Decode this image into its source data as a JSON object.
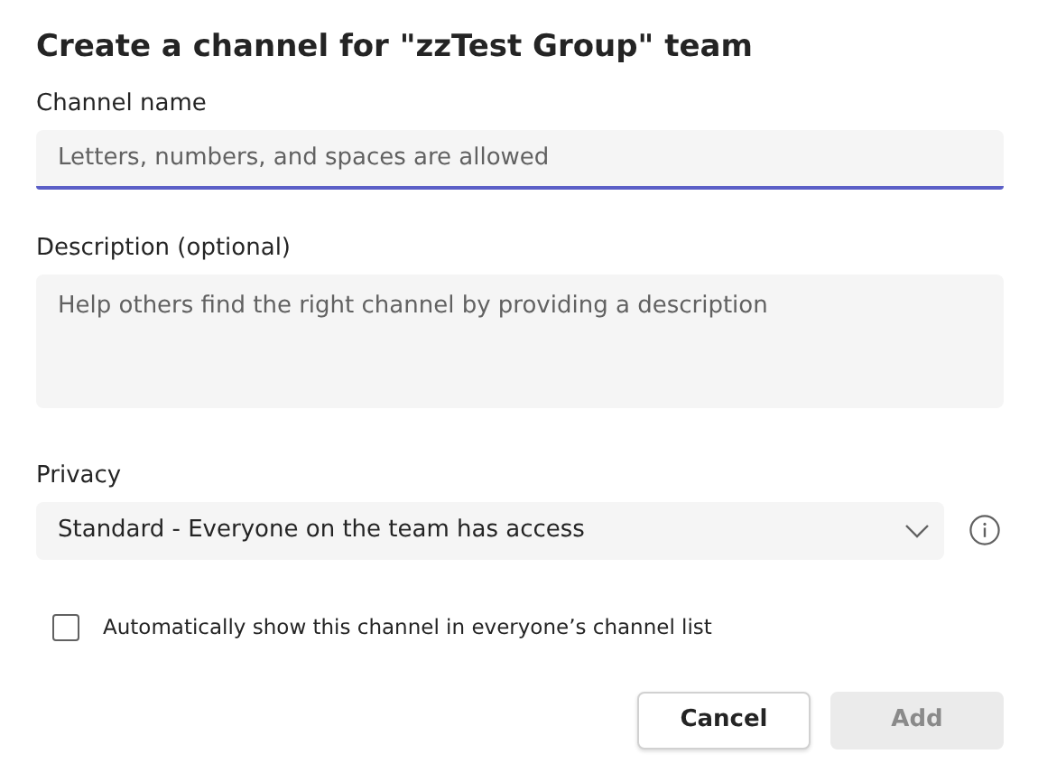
{
  "dialog": {
    "title": "Create a channel for \"zzTest Group\" team"
  },
  "channel_name": {
    "label": "Channel name",
    "placeholder": "Letters, numbers, and spaces are allowed",
    "focused": true
  },
  "description": {
    "label": "Description (optional)",
    "placeholder": "Help others find the right channel by providing a description"
  },
  "privacy": {
    "label": "Privacy",
    "value": "Standard - Everyone on the team has access"
  },
  "auto_show": {
    "label": "Automatically show this channel in everyone’s channel list",
    "checked": false
  },
  "buttons": [
    {
      "label": "Cancel",
      "kind": "secondary",
      "disabled": false
    },
    {
      "label": "Add",
      "kind": "primary",
      "disabled": true
    }
  ]
}
